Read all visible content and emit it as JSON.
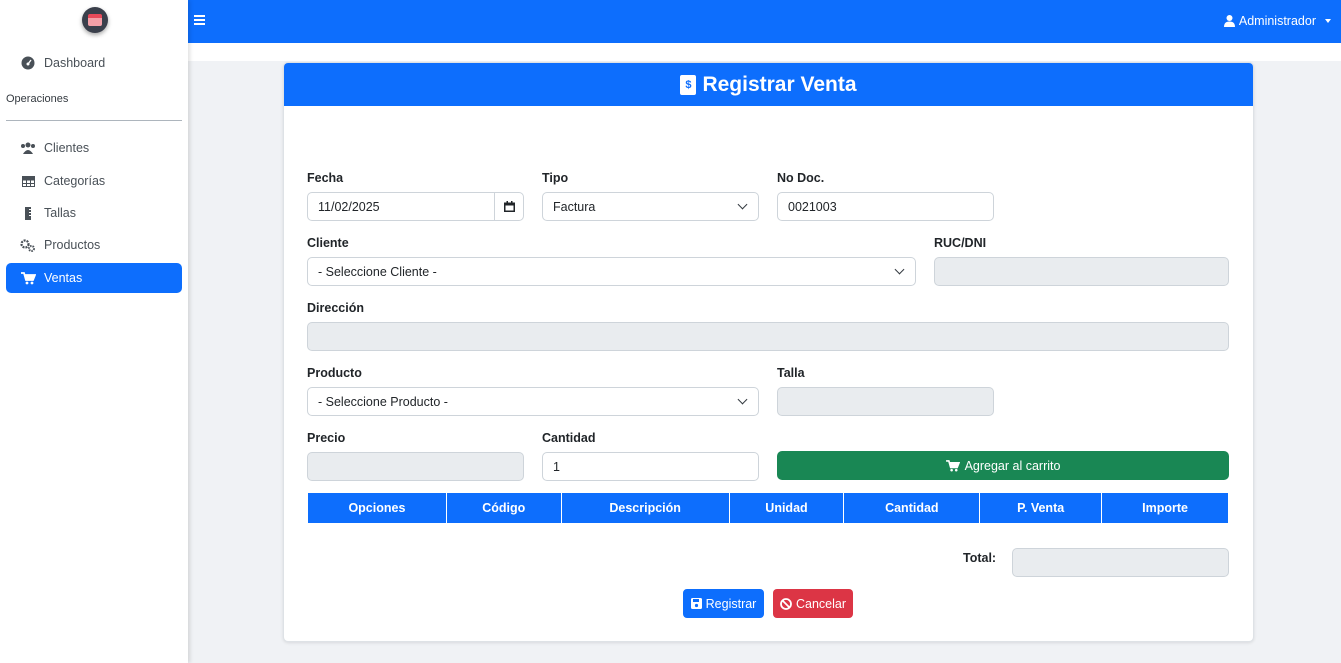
{
  "sidebar": {
    "logo": "store-logo",
    "dashboard": "Dashboard",
    "section": "Operaciones",
    "items": [
      {
        "label": "Clientes",
        "icon": "users-icon"
      },
      {
        "label": "Categorías",
        "icon": "table-icon"
      },
      {
        "label": "Tallas",
        "icon": "tag-icon"
      },
      {
        "label": "Productos",
        "icon": "gears-icon"
      },
      {
        "label": "Ventas",
        "icon": "cart-icon",
        "active": true
      }
    ]
  },
  "topbar": {
    "user": "Administrador"
  },
  "form": {
    "title": "Registrar Venta",
    "fecha_label": "Fecha",
    "fecha_value": "11/02/2025",
    "tipo_label": "Tipo",
    "tipo_value": "Factura",
    "nodoc_label": "No Doc.",
    "nodoc_value": "0021003",
    "cliente_label": "Cliente",
    "cliente_value": "- Seleccione Cliente -",
    "ruc_label": "RUC/DNI",
    "direccion_label": "Dirección",
    "producto_label": "Producto",
    "producto_value": "- Seleccione Producto -",
    "talla_label": "Talla",
    "precio_label": "Precio",
    "cantidad_label": "Cantidad",
    "cantidad_value": "1",
    "add_cart": "Agregar al carrito",
    "total_label": "Total:",
    "registrar": "Registrar",
    "cancelar": "Cancelar"
  },
  "table": {
    "headers": [
      "Opciones",
      "Código",
      "Descripción",
      "Unidad",
      "Cantidad",
      "P. Venta",
      "Importe"
    ]
  },
  "colors": {
    "primary": "#0d6efd",
    "success": "#198754",
    "danger": "#dc3545"
  }
}
